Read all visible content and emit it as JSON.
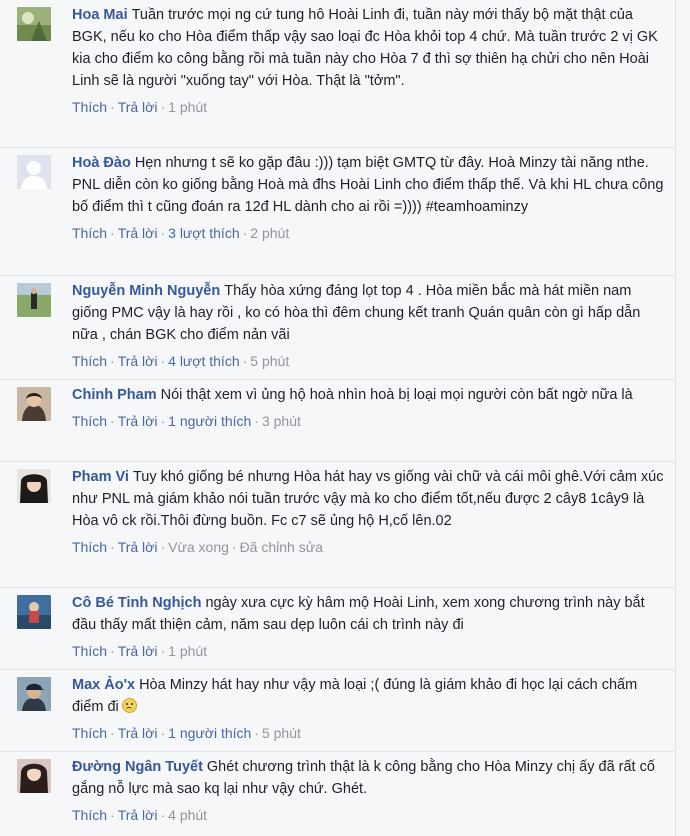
{
  "actions": {
    "like": "Thích",
    "reply": "Trả lời",
    "sep": "·"
  },
  "comments": [
    {
      "author": "Hoa Mai",
      "text": "Tuần trước mọi ng cứ tung hô Hoài Linh đi, tuần này mới thấy bộ mặt thật của BGK, nếu ko cho Hòa điểm thấp vậy sao loại đc Hòa khỏi top 4 chứ. Mà tuần trước 2 vị GK kia cho điểm ko công bằng rồi mà tuần này cho Hòa 7 đ thì sợ thiên hạ chửi cho nên Hoài Linh sẽ là người \"xuống tay\" với Hòa. Thật là \"tởm\".",
      "likes": "",
      "time": "1 phút",
      "avatar": "photo-landscape-green"
    },
    {
      "author": "Hoà Đào",
      "text": "Hẹn nhưng t sẽ ko gặp đâu :))) tạm biệt GMTQ từ đây. Hoà Minzy tài năng nthe. PNL diễn còn ko giống bằng Hoà mà đhs Hoài Linh cho điểm thấp thế. Và khi HL chưa công bố điểm thì t cũng đoán ra 12đ HL dành cho ai rồi =)))) #teamhoaminzy",
      "likes": "3 lượt thích",
      "time": "2 phút",
      "avatar": "default-silhouette"
    },
    {
      "author": "Nguyễn Minh Nguyễn",
      "text": "Thấy hòa xứng đáng lọt top 4 . Hòa miền bắc mà hát miền nam giống PMC vậy là hay rồi , ko có hòa thì đêm chung kết tranh Quán quân còn gì hấp dẫn nữa , chán BGK cho điểm nản vãi",
      "likes": "4 lượt thích",
      "time": "5 phút",
      "avatar": "photo-field-person"
    },
    {
      "author": "Chinh Pham",
      "text": "Nói thật xem vì ủng hộ hoà nhìn hoà bị loại mọi người còn bất ngờ nữa là",
      "likes": "1 người thích",
      "time": "3 phút",
      "avatar": "photo-woman-portrait"
    },
    {
      "author": "Pham Vi",
      "text": "Tuy khó giống bé nhưng Hòa hát hay vs giống vài chữ và cái môi ghê.Với cảm xúc như PNL mà giám khảo nói tuần trước vậy mà ko cho điểm tốt,nếu được 2 cây8 1cây9 là Hòa vô ck rồi.Thôi đừng buồn. Fc c7 sẽ ủng hộ H,cố lên.02",
      "likes": "",
      "time": "Vừa xong",
      "edited": "Đã chỉnh sửa",
      "avatar": "photo-girl-dark-hair"
    },
    {
      "author": "Cô Bé Tinh Nghịch",
      "text": "ngày xưa cực kỳ hâm mộ Hoài Linh, xem xong chương trình này bắt đầu thấy mất thiện cảm, năm sau dẹp luôn cái ch trình này đi",
      "likes": "",
      "time": "1 phút",
      "avatar": "photo-blue-scene"
    },
    {
      "author": "Max Ảo'x",
      "text": "Hòa Minzy hát hay như vậy mà loại ;( đúng là giám khảo đi học lại cách chấm điểm đi",
      "likes": "1 người thích",
      "time": "5 phút",
      "avatar": "photo-man-cap",
      "emoji": "sad-face-icon"
    },
    {
      "author": "Đường Ngân Tuyết",
      "text": "Ghét chương trình thật là k công bằng cho Hòa Minzy chị ấy đã rất cố gắng nỗ lực mà sao kq lại như vậy chứ. Ghét.",
      "likes": "",
      "time": "4 phút",
      "avatar": "photo-woman-long-hair"
    }
  ]
}
